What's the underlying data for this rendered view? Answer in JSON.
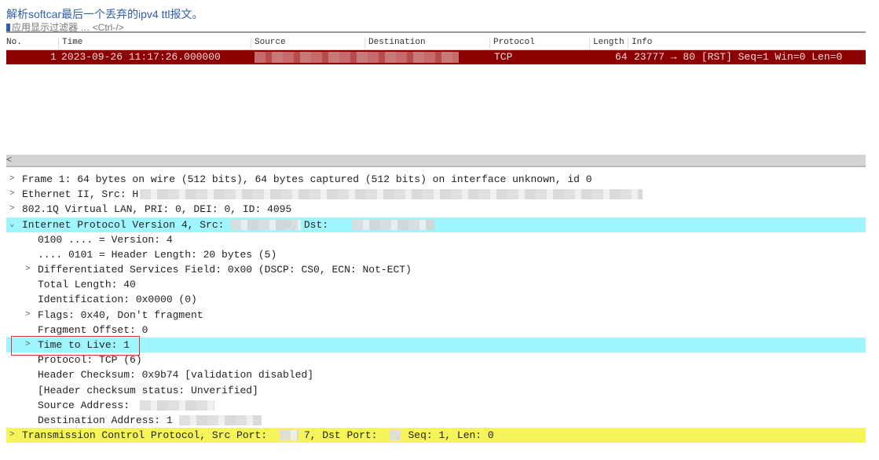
{
  "title": "解析softcar最后一个丢弃的ipv4 ttl报文。",
  "filter": {
    "placeholder": "应用显示过滤器 … <Ctrl-/>"
  },
  "columns": [
    "No.",
    "Time",
    "Source",
    "Destination",
    "Protocol",
    "Length",
    "Info"
  ],
  "packets": [
    {
      "no": "1",
      "time": "2023-09-26 11:17:26.000000",
      "protocol": "TCP",
      "length": "64",
      "info": "23777 → 80 [RST] Seq=1 Win=0 Len=0"
    }
  ],
  "scrollbar": {
    "left_arrow": "<"
  },
  "tree": [
    {
      "twisty": ">",
      "text": "Frame 1: 64 bytes on wire (512 bits), 64 bytes captured (512 bits) on interface unknown, id 0"
    },
    {
      "twisty": ">",
      "text": "Ethernet II, Src: H"
    },
    {
      "twisty": ">",
      "text": "802.1Q Virtual LAN, PRI: 0, DEI: 0, ID: 4095"
    },
    {
      "twisty": "⌄",
      "text": "Internet Protocol Version 4, Src:          0, Dst: "
    },
    {
      "twisty": "",
      "text": "0100 .... = Version: 4"
    },
    {
      "twisty": "",
      "text": ".... 0101 = Header Length: 20 bytes (5)"
    },
    {
      "twisty": ">",
      "text": "Differentiated Services Field: 0x00 (DSCP: CS0, ECN: Not-ECT)"
    },
    {
      "twisty": "",
      "text": "Total Length: 40"
    },
    {
      "twisty": "",
      "text": "Identification: 0x0000 (0)"
    },
    {
      "twisty": ">",
      "text": "Flags: 0x40, Don't fragment"
    },
    {
      "twisty": "",
      "text": "Fragment Offset: 0"
    },
    {
      "twisty": ">",
      "text": "Time to Live: 1"
    },
    {
      "twisty": "",
      "text": "Protocol: TCP (6)"
    },
    {
      "twisty": "",
      "text": "Header Checksum: 0x9b74 [validation disabled]"
    },
    {
      "twisty": "",
      "text": "[Header checksum status: Unverified]"
    },
    {
      "twisty": "",
      "text": "Source Address: "
    },
    {
      "twisty": "",
      "text": "Destination Address: 1"
    },
    {
      "twisty": ">",
      "text": "Transmission Control Protocol, Src Port:      7, Dst Port:   , Seq: 1, Len: 0"
    }
  ],
  "colors": {
    "selected_row": "#8b0000",
    "ip_highlight": "#9ff6ff",
    "tcp_highlight": "#f5f55a"
  }
}
